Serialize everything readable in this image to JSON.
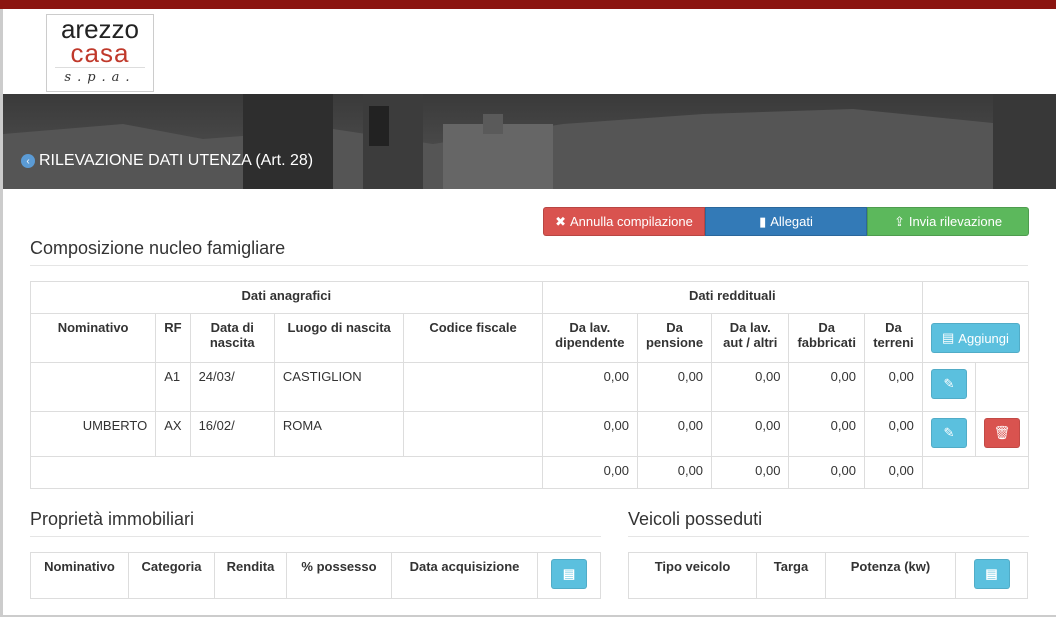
{
  "header": {
    "logo_line1": "arezzo",
    "logo_line2": "casa",
    "logo_line3": "s.p.a.",
    "banner_back_icon": "chevron-left-circle-icon",
    "page_title": "RILEVAZIONE DATI UTENZA (Art. 28)"
  },
  "actions": {
    "cancel_label": "Annulla compilazione",
    "cancel_icon": "times-icon",
    "attachments_label": "Allegati",
    "attachments_icon": "book-icon",
    "send_label": "Invia rilevazione",
    "send_icon": "send-icon",
    "colors": {
      "cancel": "#d9534f",
      "attachments": "#337ab7",
      "send": "#5cb85c"
    }
  },
  "household": {
    "title": "Composizione nucleo famigliare",
    "group_personal": "Dati anagrafici",
    "group_income": "Dati reddituali",
    "columns": {
      "name": "Nominativo",
      "rf": "RF",
      "birth_date": "Data di nascita",
      "birth_place": "Luogo di nascita",
      "tax_code": "Codice fiscale",
      "employee": "Da lav. dipendente",
      "pension": "Da pensione",
      "self_employed": "Da lav. aut / altri",
      "buildings": "Da fabbricati",
      "land": "Da terreni"
    },
    "add_label": "Aggiungi",
    "rows": [
      {
        "name": "",
        "rf": "A1",
        "birth_date": "24/03/",
        "birth_place": "CASTIGLION",
        "tax_code": "",
        "employee": "0,00",
        "pension": "0,00",
        "self_employed": "0,00",
        "buildings": "0,00",
        "land": "0,00"
      },
      {
        "name": "UMBERTO",
        "rf": "AX",
        "birth_date": "16/02/",
        "birth_place": "ROMA",
        "tax_code": "",
        "employee": "0,00",
        "pension": "0,00",
        "self_employed": "0,00",
        "buildings": "0,00",
        "land": "0,00"
      }
    ],
    "totals": {
      "employee": "0,00",
      "pension": "0,00",
      "self_employed": "0,00",
      "buildings": "0,00",
      "land": "0,00"
    }
  },
  "properties": {
    "title": "Proprietà immobiliari",
    "columns": {
      "name": "Nominativo",
      "category": "Categoria",
      "income": "Rendita",
      "ownership": "% possesso",
      "acquired": "Data acquisizione"
    }
  },
  "vehicles": {
    "title": "Veicoli posseduti",
    "columns": {
      "type": "Tipo veicolo",
      "plate": "Targa",
      "power": "Potenza (kw)"
    }
  }
}
